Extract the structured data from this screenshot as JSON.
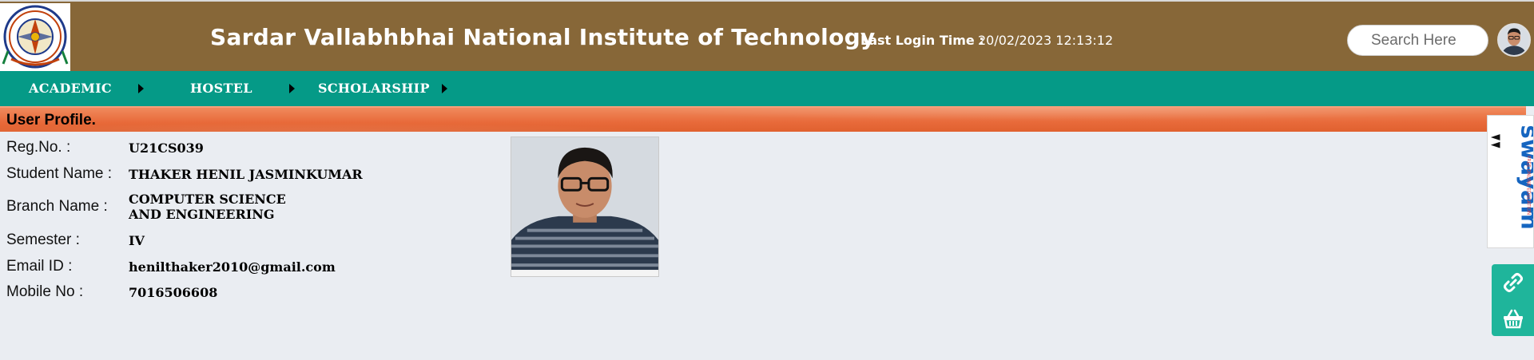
{
  "header": {
    "title": "Sardar Vallabhbhai National Institute of Technology",
    "last_login_label": "Last Login Time :",
    "last_login_value": "20/02/2023 12:13:12",
    "search_placeholder": "Search Here",
    "logo_icon": "institute-logo",
    "avatar_icon": "user-avatar"
  },
  "nav": {
    "items": [
      {
        "label": "ACADEMIC",
        "icon": "caret-right-icon"
      },
      {
        "label": "HOSTEL",
        "icon": "caret-right-icon"
      },
      {
        "label": "SCHOLARSHIP",
        "icon": "caret-right-icon"
      }
    ]
  },
  "profile": {
    "section_title": "User Profile.",
    "fields": [
      {
        "label": "Reg.No. :",
        "value": "U21CS039"
      },
      {
        "label": "Student Name :",
        "value": "THAKER HENIL JASMINKUMAR"
      },
      {
        "label": "Branch Name :",
        "value": "COMPUTER SCIENCE AND ENGINEERING"
      },
      {
        "label": "Semester :",
        "value": "IV"
      },
      {
        "label": "Email ID :",
        "value": "henilthaker2010@gmail.com"
      },
      {
        "label": "Mobile No :",
        "value": "7016506608"
      }
    ]
  },
  "side": {
    "swayam_logo": "swayam-logo",
    "buttons": [
      {
        "icon": "link-icon"
      },
      {
        "icon": "basket-icon"
      }
    ]
  },
  "colors": {
    "header_bg": "#876738",
    "nav_bg": "#059a87",
    "banner_bg": "#e86a3a",
    "page_bg": "#eaedf2",
    "side_btn_bg": "#1fb59b"
  }
}
